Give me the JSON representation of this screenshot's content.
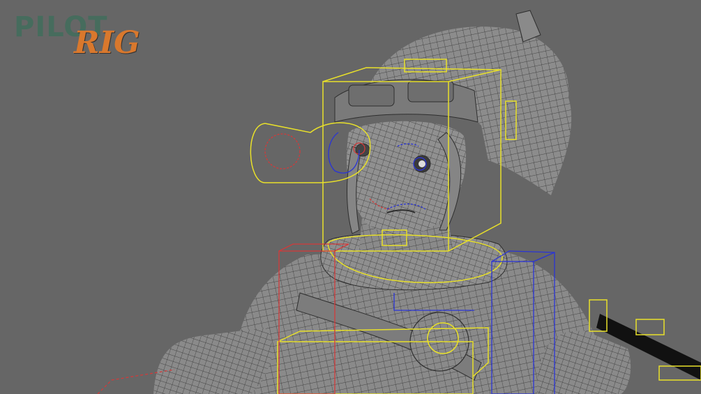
{
  "app": {
    "brand": {
      "part1": "PILOT",
      "part2": "RIG"
    }
  },
  "colors": {
    "background": "#666666",
    "mesh_fill": "#8a8a8a",
    "mesh_line": "#2e2e2e",
    "control_yellow": "#e8e02a",
    "control_red": "#d23a3a",
    "control_blue": "#2a34d6",
    "logo_pilot": "#3c6e5a",
    "logo_rig": "#d9782d"
  },
  "icons": [
    "wireframe-character-model",
    "head-control",
    "neck-control",
    "left-shoulder-control",
    "right-shoulder-control",
    "eye-aim-control"
  ]
}
